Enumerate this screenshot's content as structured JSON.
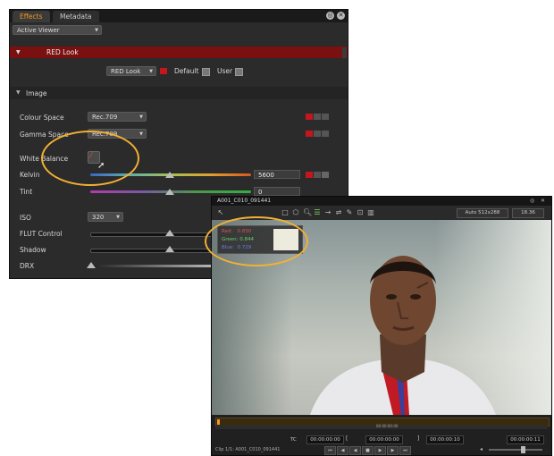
{
  "effects_panel": {
    "tabs": [
      "Effects",
      "Metadata"
    ],
    "viewer_select": "Active Viewer",
    "red_look_header": "RED Look",
    "look_select": "RED Look",
    "default_label": "Default",
    "user_label": "User",
    "image_header": "Image",
    "colour_space_label": "Colour Space",
    "colour_space_value": "Rec.709",
    "gamma_space_label": "Gamma Space",
    "gamma_space_value": "Rec.709",
    "white_balance_label": "White Balance",
    "kelvin_label": "Kelvin",
    "kelvin_value": "5600",
    "tint_label": "Tint",
    "tint_value": "0",
    "iso_label": "ISO",
    "iso_value": "320",
    "flut_label": "FLUT Control",
    "shadow_label": "Shadow",
    "drx_label": "DRX"
  },
  "viewer_panel": {
    "title": "A001_C010_091441",
    "zoom_select": "Auto 512x288",
    "fps_value": "18.36",
    "pixel_readout": {
      "red": "Red:   0.830",
      "green": "Green: 0.844",
      "blue": "Blue:  0.729"
    },
    "tc_label": "TC",
    "timecodes": [
      "00:00:00:00",
      "00:00:00:00",
      "00:00:00:10",
      "00:00:00:11"
    ],
    "timeline_tc": "00:00:00:00",
    "clip_label": "Clip 1/1: A001_C010_091441"
  },
  "colors": {
    "accent_orange": "#f39a1e",
    "annotation_ring": "#f3b033",
    "red_header": "#7a1010",
    "swatch_red": "#c4161c"
  }
}
